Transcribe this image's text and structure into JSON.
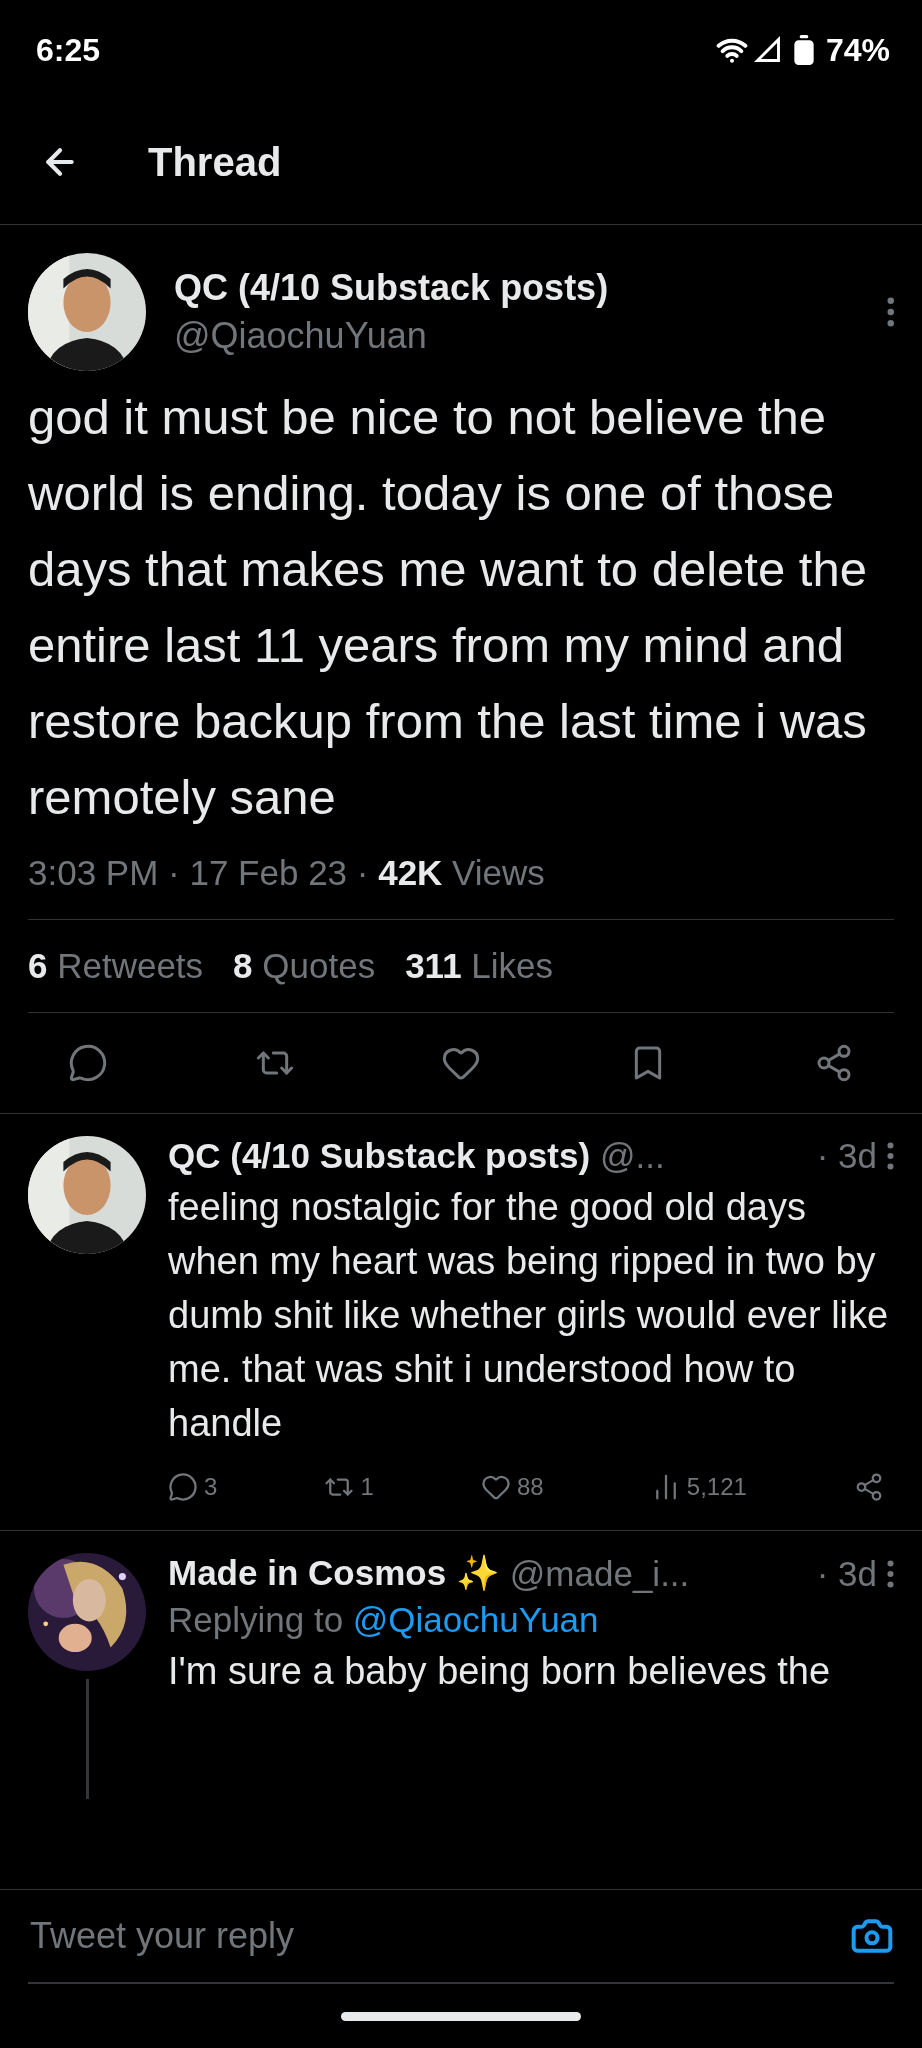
{
  "status_bar": {
    "time": "6:25",
    "battery": "74%"
  },
  "header": {
    "title": "Thread"
  },
  "main_tweet": {
    "name": "QC (4/10 Substack posts)",
    "handle": "@QiaochuYuan",
    "text": "god it must be nice to not believe the world is ending. today is one of those days that makes me want to delete the entire last 11 years from my mind and restore backup from the last time i was remotely sane",
    "meta": "3:03 PM · 17 Feb 23 · **42K** Views",
    "stats": [
      "**6** Retweets",
      "**8** Quotes",
      "**311** Likes"
    ],
    "actions": [
      {
        "kind": "reply"
      },
      {
        "kind": "retweet"
      },
      {
        "kind": "like"
      },
      {
        "kind": "bookmark"
      },
      {
        "kind": "share"
      }
    ]
  },
  "replies": [
    {
      "name": "QC (4/10 Substack posts)",
      "handle": "@...",
      "time": "· 3d",
      "thread_line": false,
      "text": "feeling nostalgic for the good old days when my heart was being ripped in two by dumb shit like whether girls would ever like me. that was shit i understood how to handle",
      "actions": [
        {
          "kind": "reply",
          "count": "3"
        },
        {
          "kind": "retweet",
          "count": "1"
        },
        {
          "kind": "like",
          "count": "88"
        },
        {
          "kind": "views",
          "count": "5,121"
        },
        {
          "kind": "share"
        }
      ]
    },
    {
      "name": "Made in Cosmos ✨",
      "handle": "@made_i...",
      "time": "· 3d",
      "thread_line": true,
      "replying_label": "Replying to",
      "replying_to": "@QiaochuYuan",
      "text": "I'm sure a baby being born believes the"
    }
  ],
  "composer": {
    "placeholder": "Tweet your reply"
  }
}
